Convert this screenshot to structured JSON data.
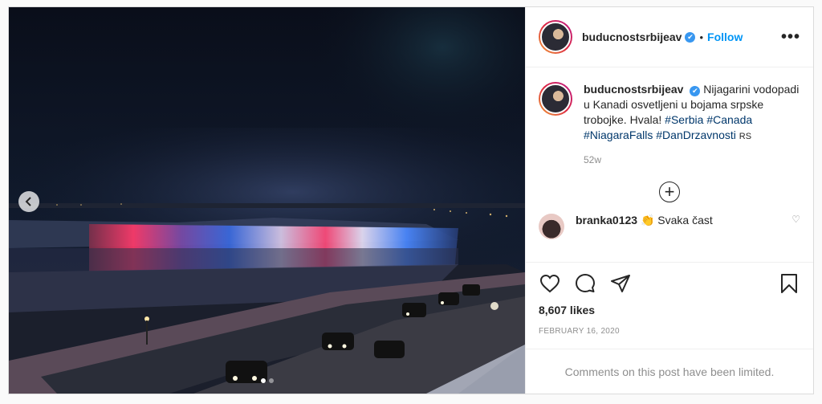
{
  "post": {
    "username": "buducnostsrbijeav",
    "verified_badge": "✔",
    "separator": "•",
    "follow_label": "Follow",
    "more_icon": "more-options-icon",
    "caption_text": "Nijagarini vodopadi u Kanadi osvetljeni u bojama srpske trobojke. Hvala!",
    "hashtags": [
      "#Serbia",
      "#Canada",
      "#NiagaraFalls",
      "#DanDrzavnosti"
    ],
    "flag_text": "RS",
    "time_ago": "52w",
    "load_more_icon": "plus-circle-icon",
    "reply": {
      "username": "branka0123",
      "emoji": "👏",
      "text": "Svaka čast"
    },
    "likes": "8,607 likes",
    "date": "FEBRUARY 16, 2020",
    "comments_limited": "Comments on this post have been limited.",
    "carousel": {
      "dots": 2,
      "active": 1
    },
    "colors": {
      "accent": "#0095f6",
      "hashtag": "#00376b",
      "muted": "#8e8e8e"
    }
  }
}
